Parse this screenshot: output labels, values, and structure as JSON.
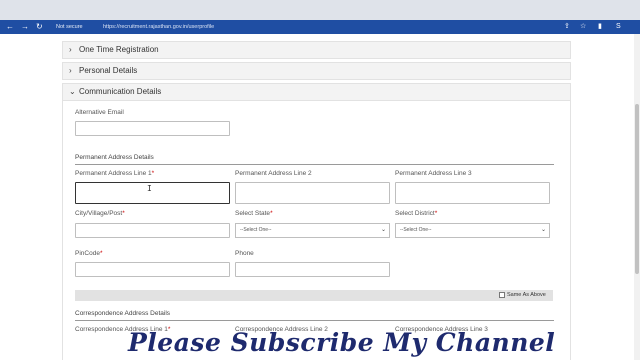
{
  "browser": {
    "back_icon": "←",
    "forward_icon": "→",
    "reload_icon": "↻",
    "security_flag": "Not secure",
    "url": "https://recruitment.rajasthan.gov.in/userprofile",
    "bar_icons": [
      "share-icon",
      "star-icon",
      "extensions-icon",
      "profile-icon"
    ]
  },
  "accordion": {
    "one_time_registration": "One Time Registration",
    "personal_details": "Personal Details",
    "communication_details": "Communication Details",
    "chevron_right": "›",
    "chevron_down": "⌄"
  },
  "form": {
    "alternative_email_label": "Alternative Email",
    "permanent_section_title": "Permanent Address Details",
    "perm_line1_label": "Permanent Address Line 1",
    "perm_line2_label": "Permanent Address Line 2",
    "perm_line3_label": "Permanent Address Line 3",
    "city_label": "City/Village/Post",
    "state_label": "Select State",
    "district_label": "Select District",
    "state_value": "--Select One--",
    "district_value": "--Select One--",
    "pincode_label": "PinCode",
    "phone_label": "Phone",
    "required_mark": "*",
    "same_as_above_label": "Same As Above",
    "correspondence_section_title": "Correspondence Address Details",
    "corr_line1_label": "Correspondence Address Line 1",
    "corr_line2_label": "Correspondence Address Line 2",
    "corr_line3_label": "Correspondence Address Line 3"
  },
  "overlay": {
    "banner_text": "Please Subscribe My Channel"
  }
}
